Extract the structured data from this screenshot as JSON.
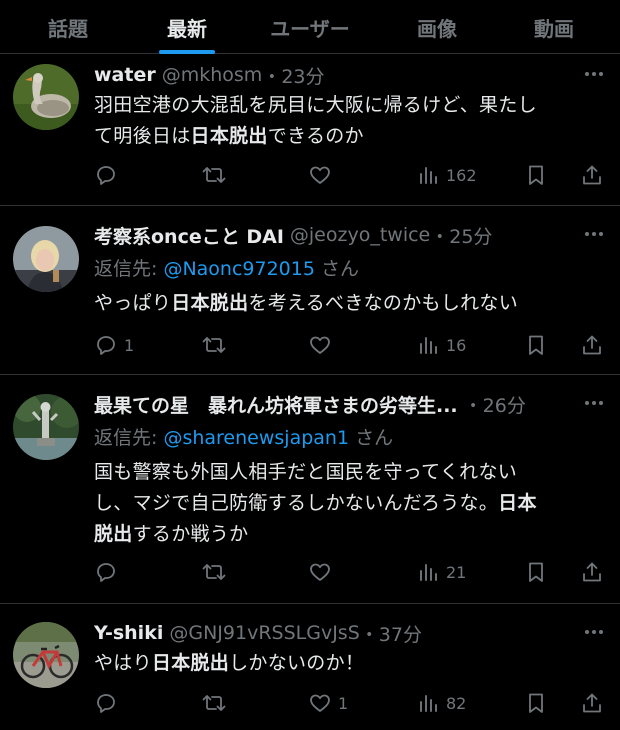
{
  "tabs": [
    {
      "label": "話題"
    },
    {
      "label": "最新"
    },
    {
      "label": "ユーザー"
    },
    {
      "label": "画像"
    },
    {
      "label": "動画"
    }
  ],
  "active_tab": "最新",
  "accent_color": "#1d9bf0",
  "tweets": [
    {
      "name": "water",
      "handle": "@mkhosm",
      "sep": "・",
      "time": "23分",
      "reply_prefix": "",
      "reply_to": "",
      "reply_suffix": "",
      "text_lines": [
        [
          "羽田空港の大混乱を尻目に大阪に帰るけど、果たし"
        ],
        [
          "て明後日は",
          "日本脱出",
          "できるのか"
        ]
      ],
      "replies": "",
      "likes": "",
      "views": "162"
    },
    {
      "name": "考察系onceこと DAI",
      "handle": "@jeozyo_twice",
      "sep": "・",
      "time": "25分",
      "reply_prefix": "返信先: ",
      "reply_to": "@Naonc972015",
      "reply_suffix": " さん",
      "text_lines": [
        [
          "やっぱり",
          "日本脱出",
          "を考えるべきなのかもしれない"
        ]
      ],
      "replies": "1",
      "likes": "",
      "views": "16"
    },
    {
      "name": "最果ての星　暴れん坊将軍さまの劣等生...",
      "handle": "",
      "sep": "・",
      "time": "26分",
      "reply_prefix": "返信先: ",
      "reply_to": "@sharenewsjapan1",
      "reply_suffix": " さん",
      "text_lines": [
        [
          "国も警察も外国人相手だと国民を守ってくれない"
        ],
        [
          "し、マジで自己防衛するしかないんだろうな。",
          "日本"
        ],
        [
          "",
          "脱出",
          "するか戦うか"
        ]
      ],
      "replies": "",
      "likes": "",
      "views": "21"
    },
    {
      "name": "Y-shiki",
      "handle": "@GNJ91vRSSLGvJsS",
      "sep": "・",
      "time": "37分",
      "reply_prefix": "",
      "reply_to": "",
      "reply_suffix": "",
      "text_lines": [
        [
          "やはり",
          "日本脱出",
          "しかないのか！"
        ]
      ],
      "replies": "",
      "likes": "1",
      "views": "82"
    }
  ],
  "icons": {
    "reply": "reply-icon",
    "retweet": "retweet-icon",
    "like": "heart-icon",
    "views": "views-icon",
    "bookmark": "bookmark-icon",
    "share": "share-icon",
    "more": "more-icon"
  }
}
